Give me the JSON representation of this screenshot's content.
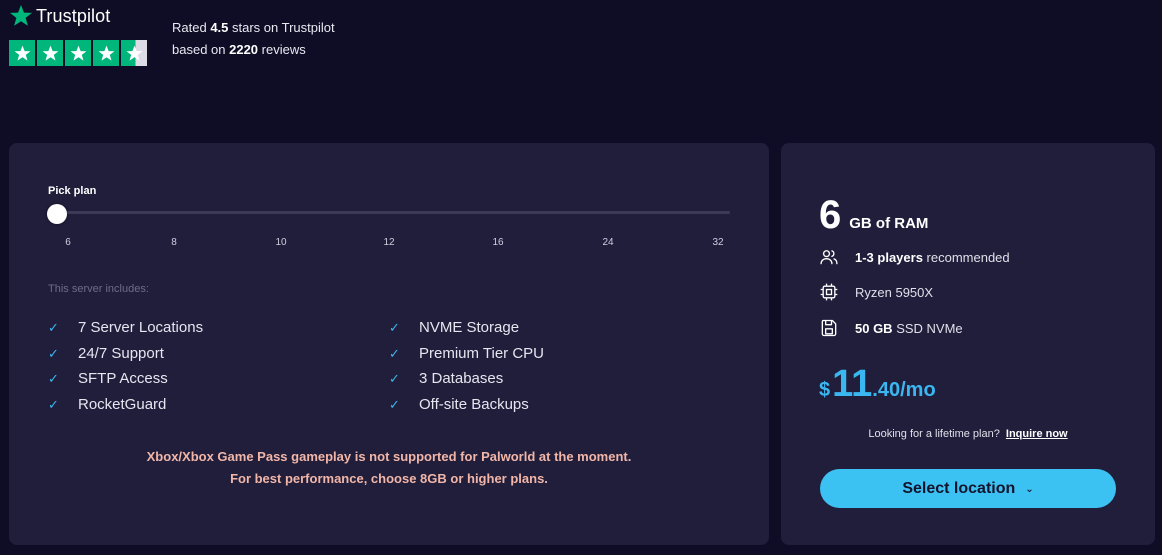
{
  "trustpilot": {
    "brand": "Trustpilot",
    "rating_prefix": "Rated ",
    "rating_value": "4.5",
    "rating_suffix": " stars on Trustpilot",
    "reviews_prefix": "based on ",
    "reviews_count": "2220",
    "reviews_suffix": " reviews",
    "stars_rating": 4.5,
    "brand_color": "#00b67a"
  },
  "plan_picker": {
    "label": "Pick plan",
    "ticks": [
      "6",
      "8",
      "10",
      "12",
      "16",
      "24",
      "32"
    ],
    "selected": "6"
  },
  "includes": {
    "label": "This server includes:",
    "left": [
      "7 Server Locations",
      "24/7 Support",
      "SFTP Access",
      "RocketGuard"
    ],
    "right": [
      "NVME Storage",
      "Premium Tier CPU",
      "3 Databases",
      "Off-site Backups"
    ]
  },
  "warning": {
    "line1": "Xbox/Xbox Game Pass gameplay is not supported for Palworld at the moment.",
    "line2": "For best performance, choose 8GB or higher plans."
  },
  "summary": {
    "ram_value": "6",
    "ram_unit": "GB of RAM",
    "players_bold": "1-3 players",
    "players_rest": " recommended",
    "cpu": "Ryzen 5950X",
    "storage_bold": "50 GB",
    "storage_rest": " SSD NVMe",
    "price_currency": "$",
    "price_int": "11",
    "price_dec": ".40/mo",
    "lifetime_text": "Looking for a lifetime plan?",
    "lifetime_link": "Inquire now",
    "select_label": "Select location",
    "accent_color": "#3ab7f0"
  },
  "icons": [
    "star-icon",
    "users-icon",
    "cpu-icon",
    "save-icon",
    "chevron-down-icon",
    "check-icon"
  ]
}
